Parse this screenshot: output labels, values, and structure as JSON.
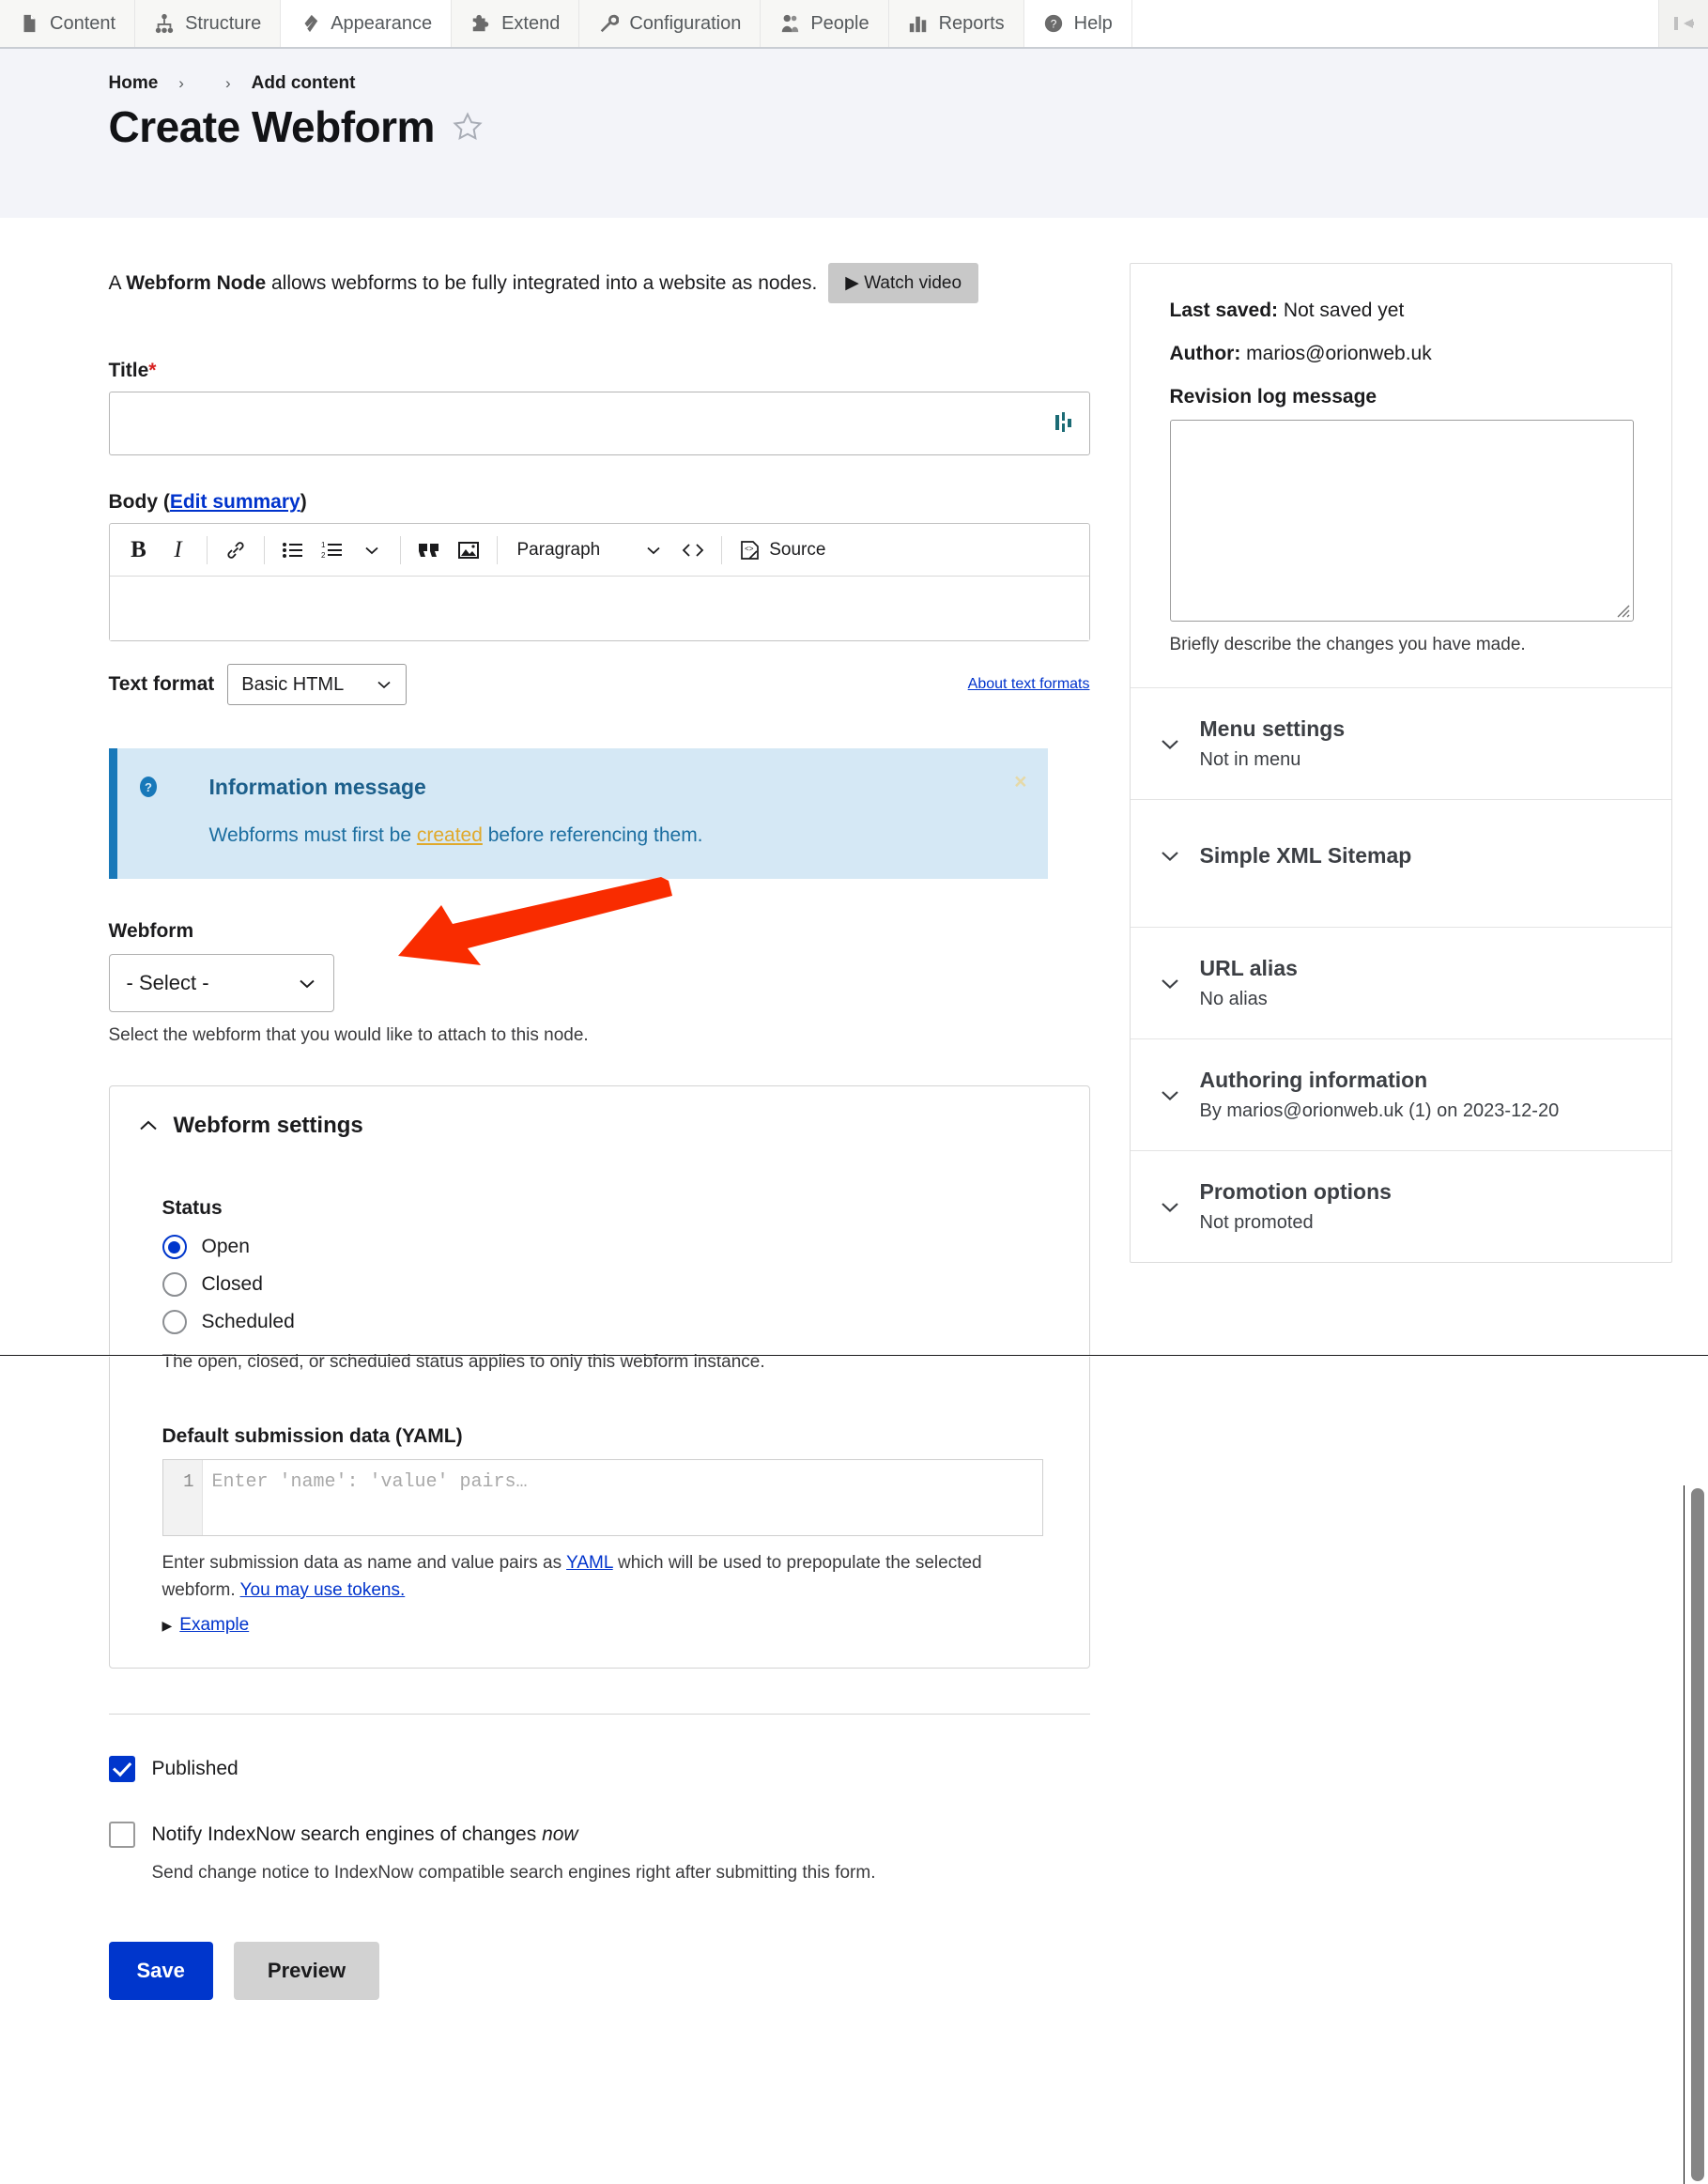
{
  "toolbar": {
    "items": [
      {
        "label": "Content",
        "icon": "content-icon"
      },
      {
        "label": "Structure",
        "icon": "structure-icon"
      },
      {
        "label": "Appearance",
        "icon": "appearance-icon"
      },
      {
        "label": "Extend",
        "icon": "extend-icon"
      },
      {
        "label": "Configuration",
        "icon": "configuration-icon"
      },
      {
        "label": "People",
        "icon": "people-icon"
      },
      {
        "label": "Reports",
        "icon": "reports-icon"
      },
      {
        "label": "Help",
        "icon": "help-icon"
      }
    ],
    "collapse_icon": "collapse-toolbar-icon"
  },
  "header": {
    "breadcrumb": [
      "Home",
      "",
      "Add content"
    ],
    "title": "Create Webform",
    "favorite_icon": "star-outline-icon"
  },
  "intro": {
    "text_before": "A ",
    "text_bold": "Webform Node",
    "text_after": " allows webforms to be fully integrated into a website as nodes.",
    "watch_video_label": "▶ Watch video"
  },
  "form": {
    "title_label": "Title",
    "title_required_mark": "*",
    "title_value": "",
    "body_label": "Body",
    "body_edit_summary": "Edit summary",
    "editor": {
      "bold": "B",
      "italic": "I",
      "link_icon": "link-icon",
      "bulleted_list_icon": "bulleted-list-icon",
      "numbered_list_icon": "numbered-list-icon",
      "list_dropdown_icon": "chevron-down-icon",
      "blockquote_icon": "blockquote-icon",
      "image_icon": "image-icon",
      "paragraph_label": "Paragraph",
      "paragraph_dropdown_icon": "chevron-down-icon",
      "code_icon": "code-icon",
      "source_label": "Source",
      "source_icon": "source-editing-icon",
      "content": ""
    },
    "text_format_label": "Text format",
    "text_format_value": "Basic HTML",
    "about_text_formats": "About text formats"
  },
  "message": {
    "icon": "info-question-icon",
    "title": "Information message",
    "body_before": "Webforms must first be ",
    "body_link": "created",
    "body_after": " before referencing them.",
    "close_label": "×",
    "accent_color": "#1878b9",
    "background_color": "#d5e8f5"
  },
  "webform": {
    "label": "Webform",
    "selected": "- Select -",
    "dropdown_icon": "chevron-down-icon",
    "description": "Select the webform that you would like to attach to this node.",
    "annotation_arrow_color": "#f92c00"
  },
  "webform_settings": {
    "heading": "Webform settings",
    "collapse_icon": "chevron-up-icon",
    "status_label": "Status",
    "status_options": [
      {
        "label": "Open",
        "selected": true
      },
      {
        "label": "Closed",
        "selected": false
      },
      {
        "label": "Scheduled",
        "selected": false
      }
    ],
    "status_help": "The open, closed, or scheduled status applies to only this webform instance.",
    "yaml_label": "Default submission data (YAML)",
    "yaml_line_number": "1",
    "yaml_placeholder": "Enter 'name': 'value' pairs…",
    "yaml_help_before": "Enter submission data as name and value pairs as ",
    "yaml_help_link": "YAML",
    "yaml_help_mid": " which will be used to prepopulate the selected webform. ",
    "yaml_help_link2": "You may use tokens.",
    "example_label": "Example",
    "example_icon": "triangle-right-icon"
  },
  "bottom": {
    "published_label": "Published",
    "published_checked": true,
    "indexnow_label_before": "Notify IndexNow search engines of changes ",
    "indexnow_label_italic": "now",
    "indexnow_checked": false,
    "indexnow_help": "Send change notice to IndexNow compatible search engines right after submitting this form.",
    "save_label": "Save",
    "preview_label": "Preview",
    "save_color": "#0036cc"
  },
  "sidebar": {
    "last_saved_label": "Last saved:",
    "last_saved_value": " Not saved yet",
    "author_label": "Author:",
    "author_value": " marios@orionweb.uk",
    "revision_log_label": "Revision log message",
    "revision_log_value": "",
    "revision_log_help": "Briefly describe the changes you have made.",
    "sections": [
      {
        "title": "Menu settings",
        "summary": "Not in menu",
        "icon": "chevron-down-icon"
      },
      {
        "title": "Simple XML Sitemap",
        "summary": "",
        "icon": "chevron-down-icon"
      },
      {
        "title": "URL alias",
        "summary": "No alias",
        "icon": "chevron-down-icon"
      },
      {
        "title": "Authoring information",
        "summary": "By marios@orionweb.uk (1) on 2023-12-20",
        "icon": "chevron-down-icon"
      },
      {
        "title": "Promotion options",
        "summary": "Not promoted",
        "icon": "chevron-down-icon"
      }
    ]
  }
}
